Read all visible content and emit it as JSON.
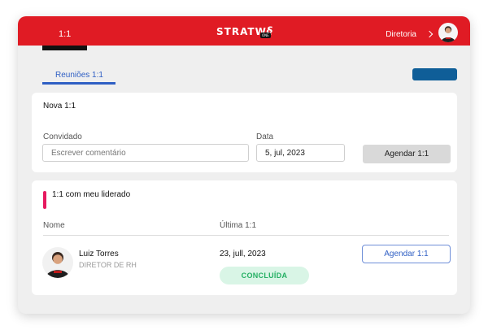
{
  "header": {
    "page_label": "1:1",
    "logo_text": "STRATW",
    "logo_mark": "§",
    "logo_badge": "ONE",
    "user_menu_label": "Diretoria",
    "accent_color": "#e01b24"
  },
  "tabs": [
    {
      "label": "Reuniões 1:1",
      "active": true
    }
  ],
  "new_meeting": {
    "title": "Nova 1:1",
    "guest_label": "Convidado",
    "guest_placeholder": "Escrever comentário",
    "date_label": "Data",
    "date_value": "5, jul, 2023",
    "schedule_button": "Agendar 1:1"
  },
  "led_list": {
    "title": "1:1 com meu liderado",
    "columns": {
      "name": "Nome",
      "last": "Última 1:1"
    },
    "rows": [
      {
        "name": "Luiz Torres",
        "role": "DIRETOR DE RH",
        "last_date": "23, jull, 2023",
        "status": "CONCLUÍDA",
        "action": "Agendar 1:1"
      }
    ]
  },
  "icons": {
    "chevron": "chevron-right-icon",
    "avatar": "user-avatar-icon"
  }
}
